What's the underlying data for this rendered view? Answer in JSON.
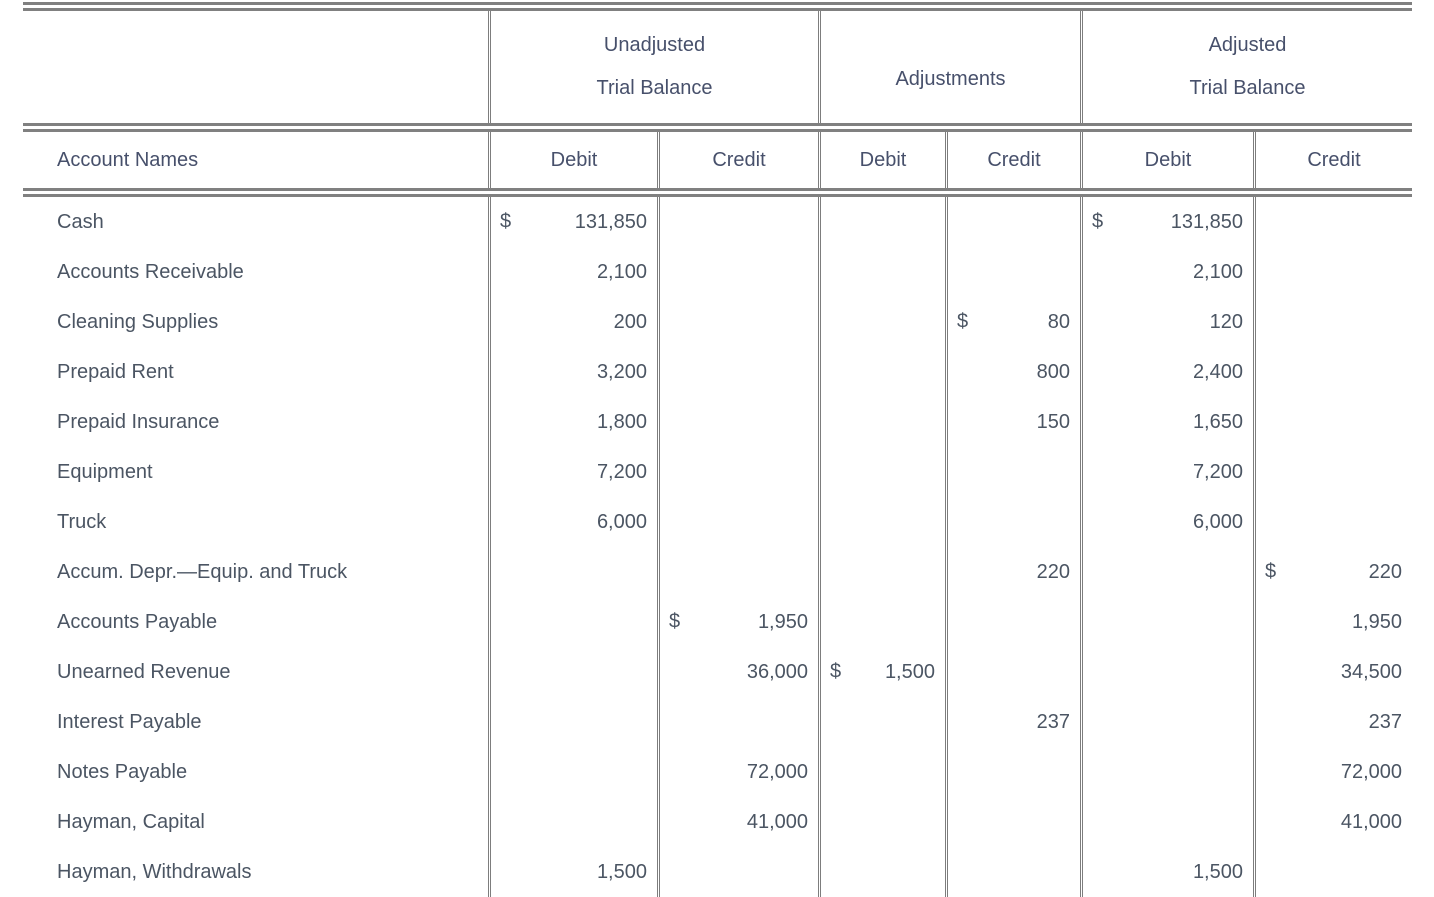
{
  "header": {
    "groups": [
      {
        "label_line1": "",
        "label_line2": "",
        "name": "account-names-group"
      },
      {
        "label_line1": "Unadjusted",
        "label_line2": "Trial Balance",
        "name": "unadjusted-trial-balance-group"
      },
      {
        "label_line1": "",
        "label_line2": "Adjustments",
        "name": "adjustments-group"
      },
      {
        "label_line1": "Adjusted",
        "label_line2": "Trial Balance",
        "name": "adjusted-trial-balance-group"
      }
    ],
    "columns": {
      "account_names": "Account Names",
      "utb_debit": "Debit",
      "utb_credit": "Credit",
      "adj_debit": "Debit",
      "adj_credit": "Credit",
      "atb_debit": "Debit",
      "atb_credit": "Credit"
    }
  },
  "rows": [
    {
      "account": "Cash",
      "utb_debit_cur": "$",
      "utb_debit": "131,850",
      "utb_credit_cur": "",
      "utb_credit": "",
      "adj_debit_cur": "",
      "adj_debit": "",
      "adj_credit_cur": "",
      "adj_credit": "",
      "atb_debit_cur": "$",
      "atb_debit": "131,850",
      "atb_credit_cur": "",
      "atb_credit": ""
    },
    {
      "account": "Accounts Receivable",
      "utb_debit_cur": "",
      "utb_debit": "2,100",
      "utb_credit_cur": "",
      "utb_credit": "",
      "adj_debit_cur": "",
      "adj_debit": "",
      "adj_credit_cur": "",
      "adj_credit": "",
      "atb_debit_cur": "",
      "atb_debit": "2,100",
      "atb_credit_cur": "",
      "atb_credit": ""
    },
    {
      "account": "Cleaning Supplies",
      "utb_debit_cur": "",
      "utb_debit": "200",
      "utb_credit_cur": "",
      "utb_credit": "",
      "adj_debit_cur": "",
      "adj_debit": "",
      "adj_credit_cur": "$",
      "adj_credit": "80",
      "atb_debit_cur": "",
      "atb_debit": "120",
      "atb_credit_cur": "",
      "atb_credit": ""
    },
    {
      "account": "Prepaid Rent",
      "utb_debit_cur": "",
      "utb_debit": "3,200",
      "utb_credit_cur": "",
      "utb_credit": "",
      "adj_debit_cur": "",
      "adj_debit": "",
      "adj_credit_cur": "",
      "adj_credit": "800",
      "atb_debit_cur": "",
      "atb_debit": "2,400",
      "atb_credit_cur": "",
      "atb_credit": ""
    },
    {
      "account": "Prepaid Insurance",
      "utb_debit_cur": "",
      "utb_debit": "1,800",
      "utb_credit_cur": "",
      "utb_credit": "",
      "adj_debit_cur": "",
      "adj_debit": "",
      "adj_credit_cur": "",
      "adj_credit": "150",
      "atb_debit_cur": "",
      "atb_debit": "1,650",
      "atb_credit_cur": "",
      "atb_credit": ""
    },
    {
      "account": "Equipment",
      "utb_debit_cur": "",
      "utb_debit": "7,200",
      "utb_credit_cur": "",
      "utb_credit": "",
      "adj_debit_cur": "",
      "adj_debit": "",
      "adj_credit_cur": "",
      "adj_credit": "",
      "atb_debit_cur": "",
      "atb_debit": "7,200",
      "atb_credit_cur": "",
      "atb_credit": ""
    },
    {
      "account": "Truck",
      "utb_debit_cur": "",
      "utb_debit": "6,000",
      "utb_credit_cur": "",
      "utb_credit": "",
      "adj_debit_cur": "",
      "adj_debit": "",
      "adj_credit_cur": "",
      "adj_credit": "",
      "atb_debit_cur": "",
      "atb_debit": "6,000",
      "atb_credit_cur": "",
      "atb_credit": ""
    },
    {
      "account": "Accum. Depr.—Equip. and Truck",
      "utb_debit_cur": "",
      "utb_debit": "",
      "utb_credit_cur": "",
      "utb_credit": "",
      "adj_debit_cur": "",
      "adj_debit": "",
      "adj_credit_cur": "",
      "adj_credit": "220",
      "atb_debit_cur": "",
      "atb_debit": "",
      "atb_credit_cur": "$",
      "atb_credit": "220"
    },
    {
      "account": "Accounts Payable",
      "utb_debit_cur": "",
      "utb_debit": "",
      "utb_credit_cur": "$",
      "utb_credit": "1,950",
      "adj_debit_cur": "",
      "adj_debit": "",
      "adj_credit_cur": "",
      "adj_credit": "",
      "atb_debit_cur": "",
      "atb_debit": "",
      "atb_credit_cur": "",
      "atb_credit": "1,950"
    },
    {
      "account": "Unearned Revenue",
      "utb_debit_cur": "",
      "utb_debit": "",
      "utb_credit_cur": "",
      "utb_credit": "36,000",
      "adj_debit_cur": "$",
      "adj_debit": "1,500",
      "adj_credit_cur": "",
      "adj_credit": "",
      "atb_debit_cur": "",
      "atb_debit": "",
      "atb_credit_cur": "",
      "atb_credit": "34,500"
    },
    {
      "account": "Interest Payable",
      "utb_debit_cur": "",
      "utb_debit": "",
      "utb_credit_cur": "",
      "utb_credit": "",
      "adj_debit_cur": "",
      "adj_debit": "",
      "adj_credit_cur": "",
      "adj_credit": "237",
      "atb_debit_cur": "",
      "atb_debit": "",
      "atb_credit_cur": "",
      "atb_credit": "237"
    },
    {
      "account": "Notes Payable",
      "utb_debit_cur": "",
      "utb_debit": "",
      "utb_credit_cur": "",
      "utb_credit": "72,000",
      "adj_debit_cur": "",
      "adj_debit": "",
      "adj_credit_cur": "",
      "adj_credit": "",
      "atb_debit_cur": "",
      "atb_debit": "",
      "atb_credit_cur": "",
      "atb_credit": "72,000"
    },
    {
      "account": "Hayman, Capital",
      "utb_debit_cur": "",
      "utb_debit": "",
      "utb_credit_cur": "",
      "utb_credit": "41,000",
      "adj_debit_cur": "",
      "adj_debit": "",
      "adj_credit_cur": "",
      "adj_credit": "",
      "atb_debit_cur": "",
      "atb_debit": "",
      "atb_credit_cur": "",
      "atb_credit": "41,000"
    },
    {
      "account": "Hayman, Withdrawals",
      "utb_debit_cur": "",
      "utb_debit": "1,500",
      "utb_credit_cur": "",
      "utb_credit": "",
      "adj_debit_cur": "",
      "adj_debit": "",
      "adj_credit_cur": "",
      "adj_credit": "",
      "atb_debit_cur": "",
      "atb_debit": "1,500",
      "atb_credit_cur": "",
      "atb_credit": ""
    }
  ],
  "colors": {
    "rule": "#808080",
    "header_text": "#47506b",
    "body_text": "#4b5563",
    "background": "#ffffff"
  }
}
